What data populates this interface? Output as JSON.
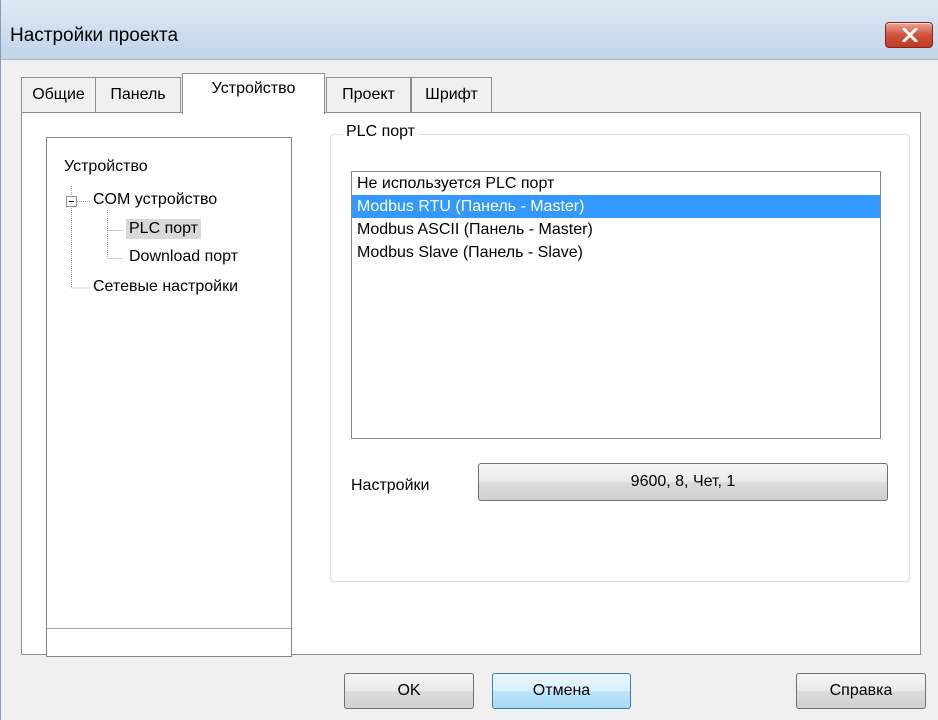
{
  "window": {
    "title": "Настройки проекта",
    "close_icon": "close-x-icon"
  },
  "tabs": [
    {
      "label": "Общие",
      "active": false
    },
    {
      "label": "Панель",
      "active": false
    },
    {
      "label": "Устройство",
      "active": true
    },
    {
      "label": "Проект",
      "active": false
    },
    {
      "label": "Шрифт",
      "active": false
    }
  ],
  "tree": {
    "root": "Устройство",
    "com_device": "COM устройство",
    "plc_port": "PLC порт",
    "download_port": "Download порт",
    "network_settings": "Сетевые настройки",
    "expander_icon": "minus-box-icon"
  },
  "plc_group": {
    "label": "PLC порт",
    "options": [
      "Не используется PLC порт",
      "Modbus RTU (Панель - Master)",
      "Modbus ASCII (Панель - Master)",
      "Modbus Slave (Панель - Slave)"
    ],
    "selected_index": 1,
    "settings_label": "Настройки",
    "settings_value": "9600, 8, Чет, 1"
  },
  "buttons": {
    "ok": "OK",
    "cancel": "Отмена",
    "help": "Справка"
  },
  "colors": {
    "selection": "#3399ff",
    "close_button": "#c13a22"
  }
}
